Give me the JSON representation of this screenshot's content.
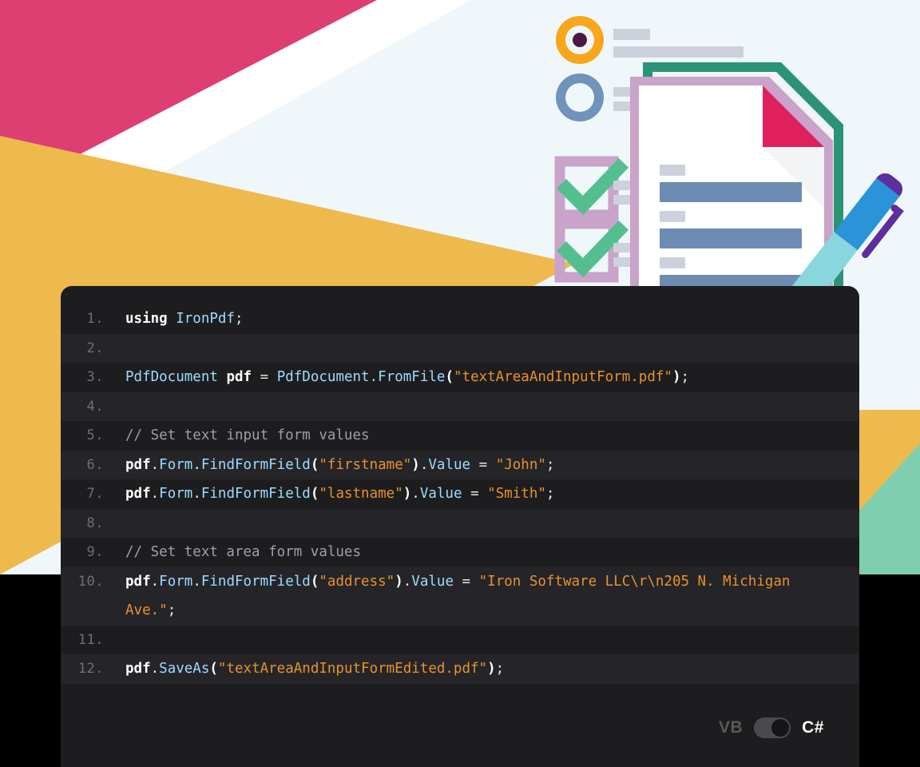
{
  "illustration": {
    "name": "pdf-form-fields-illustration",
    "background_shapes": [
      {
        "name": "light-blue-backdrop",
        "color": "#eff7fa"
      },
      {
        "name": "pink-triangle",
        "color": "#dd3f72"
      },
      {
        "name": "white-triangle",
        "color": "#ffffff"
      },
      {
        "name": "yellow-triangle-left",
        "color": "#eeba4d"
      },
      {
        "name": "yellow-triangle-right",
        "color": "#eeba4d"
      },
      {
        "name": "green-triangle-right",
        "color": "#7fceb0"
      }
    ],
    "radio_selected": {
      "name": "radio-selected",
      "ring_color": "#f9a61a",
      "dot_color": "#4a1942"
    },
    "radio_unselected": {
      "name": "radio-unselected",
      "ring_color": "#6f93bb"
    },
    "checkboxes": [
      {
        "name": "checkbox-checked-1",
        "box_color": "#c9a3c9",
        "check_color": "#53bf8e"
      },
      {
        "name": "checkbox-checked-2",
        "box_color": "#c9a3c9",
        "check_color": "#53bf8e"
      }
    ],
    "document": {
      "back_sheet_color": "#2b9476",
      "front_border_color": "#c9a3c9",
      "page_color": "#ffffff",
      "folded_corner_color": "#e0205c",
      "field_label_color": "#cdd1dc",
      "field_input_color": "#6d8cb4",
      "field_rows": 3
    },
    "pen": {
      "name": "pen-icon",
      "cap_color": "#5e2d9e",
      "barrel_color": "#2b93d7",
      "grip_color": "#8ad6dd",
      "tip_color": "#5e2d9e",
      "clip_color": "#5e2d9e"
    }
  },
  "code_panel": {
    "name": "code-sample-panel",
    "background": "#1d1d1f",
    "alt_row_background": "#252529",
    "language": "C#",
    "lines": [
      {
        "n": "1.",
        "shaded": false
      },
      {
        "n": "2.",
        "shaded": true
      },
      {
        "n": "3.",
        "shaded": false
      },
      {
        "n": "4.",
        "shaded": true
      },
      {
        "n": "5.",
        "shaded": false
      },
      {
        "n": "6.",
        "shaded": true
      },
      {
        "n": "7.",
        "shaded": false
      },
      {
        "n": "8.",
        "shaded": true
      },
      {
        "n": "9.",
        "shaded": false
      },
      {
        "n": "10.",
        "shaded": true
      },
      {
        "n": "11.",
        "shaded": false
      },
      {
        "n": "12.",
        "shaded": true
      }
    ],
    "plain_code": [
      "using IronPdf;",
      "",
      "PdfDocument pdf = PdfDocument.FromFile(\"textAreaAndInputForm.pdf\");",
      "",
      "// Set text input form values",
      "pdf.Form.FindFormField(\"firstname\").Value = \"John\";",
      "pdf.Form.FindFormField(\"lastname\").Value = \"Smith\";",
      "",
      "// Set text area form values",
      "pdf.Form.FindFormField(\"address\").Value = \"Iron Software LLC\\r\\n205 N. Michigan Ave.\";",
      "",
      "pdf.SaveAs(\"textAreaAndInputFormEdited.pdf\");"
    ],
    "tokens": {
      "l1_using": "using",
      "l1_ns": "IronPdf",
      "l1_semi": ";",
      "l3_type": "PdfDocument",
      "l3_var": "pdf",
      "l3_eq": "=",
      "l3_class": "PdfDocument",
      "l3_dot": ".",
      "l3_method": "FromFile",
      "l3_open": "(",
      "l3_arg": "\"textAreaAndInputForm.pdf\"",
      "l3_close": ")",
      "l3_semi": ";",
      "l5_comment": "// Set text input form values",
      "l6_obj": "pdf",
      "l6_dot1": ".",
      "l6_form": "Form",
      "l6_dot2": ".",
      "l6_method": "FindFormField",
      "l6_open": "(",
      "l6_arg": "\"firstname\"",
      "l6_close": ")",
      "l6_dot3": ".",
      "l6_prop": "Value",
      "l6_eq": "=",
      "l6_val": "\"John\"",
      "l6_semi": ";",
      "l7_obj": "pdf",
      "l7_dot1": ".",
      "l7_form": "Form",
      "l7_dot2": ".",
      "l7_method": "FindFormField",
      "l7_open": "(",
      "l7_arg": "\"lastname\"",
      "l7_close": ")",
      "l7_dot3": ".",
      "l7_prop": "Value",
      "l7_eq": "=",
      "l7_val": "\"Smith\"",
      "l7_semi": ";",
      "l9_comment": "// Set text area form values",
      "l10_obj": "pdf",
      "l10_dot1": ".",
      "l10_form": "Form",
      "l10_dot2": ".",
      "l10_method": "FindFormField",
      "l10_open": "(",
      "l10_arg": "\"address\"",
      "l10_close": ")",
      "l10_dot3": ".",
      "l10_prop": "Value",
      "l10_eq": "=",
      "l10_val": "\"Iron Software LLC\\r\\n205 N. Michigan Ave.\"",
      "l10_semi": ";",
      "l12_obj": "pdf",
      "l12_dot1": ".",
      "l12_method": "SaveAs",
      "l12_open": "(",
      "l12_arg": "\"textAreaAndInputFormEdited.pdf\"",
      "l12_close": ")",
      "l12_semi": ";"
    }
  },
  "language_toggle": {
    "name": "language-toggle",
    "left_label": "VB",
    "right_label": "C#",
    "active": "C#",
    "knob_position": "right",
    "track_color": "#4a4a4d",
    "knob_color": "#151517"
  }
}
